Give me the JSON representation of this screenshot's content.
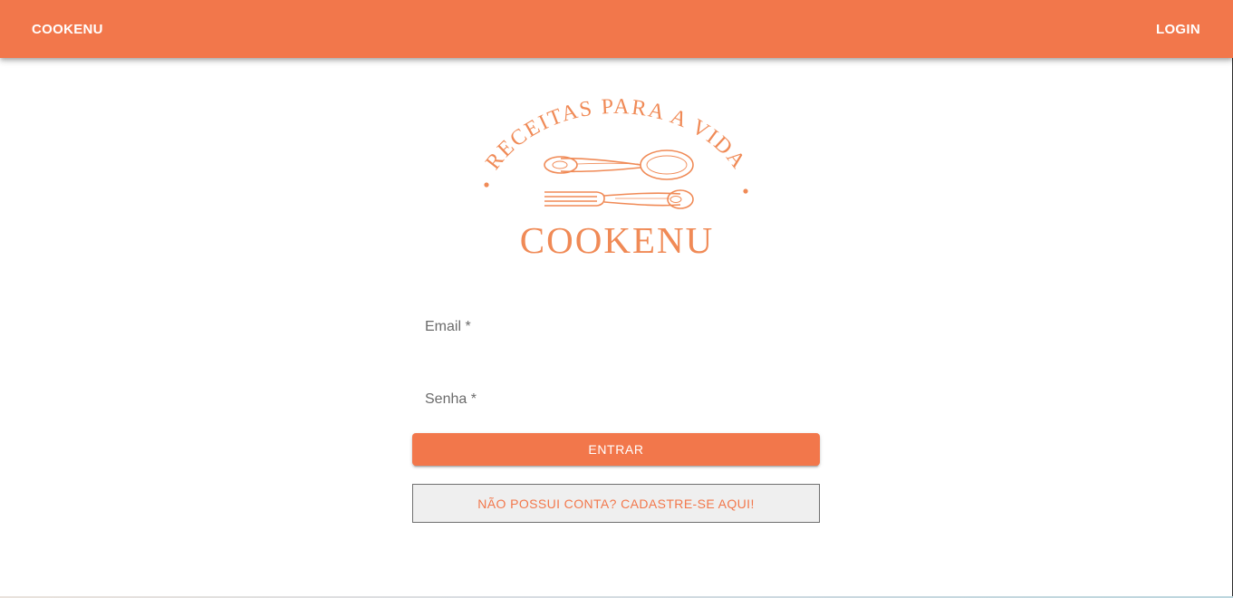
{
  "appbar": {
    "brand_label": "COOKENU",
    "login_label": "LOGIN",
    "background_color": "#f2774b"
  },
  "logo": {
    "arc_text": "RECEITAS PARA A VIDA",
    "name": "COOKENU",
    "color": "#f08a56",
    "icons": [
      "spoon-icon",
      "fork-icon"
    ]
  },
  "form": {
    "email_label": "Email *",
    "password_label": "Senha *",
    "submit_label": "ENTRAR",
    "signup_label": "NÃO POSSUI CONTA? CADASTRE-SE AQUI!"
  },
  "colors": {
    "accent": "#f2774b",
    "signup_background": "#efefef"
  }
}
